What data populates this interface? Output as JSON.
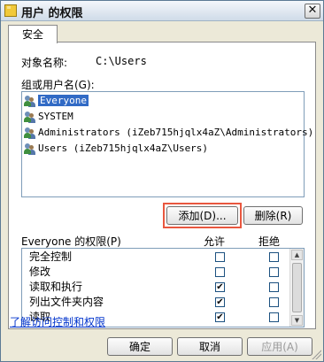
{
  "window": {
    "title": "用户 的权限",
    "close_label": "✕"
  },
  "tabs": [
    {
      "label": "安全"
    }
  ],
  "object": {
    "label": "对象名称:",
    "value": "C:\\Users"
  },
  "group_list": {
    "label": "组或用户名(G):",
    "items": [
      {
        "name": "Everyone",
        "selected": true
      },
      {
        "name": "SYSTEM",
        "selected": false
      },
      {
        "name": "Administrators (iZeb715hjqlx4aZ\\Administrators)",
        "selected": false
      },
      {
        "name": "Users (iZeb715hjqlx4aZ\\Users)",
        "selected": false
      }
    ]
  },
  "buttons": {
    "add": "添加(D)...",
    "remove": "删除(R)",
    "ok": "确定",
    "cancel": "取消",
    "apply": "应用(A)"
  },
  "permissions": {
    "title": "Everyone 的权限(P)",
    "allow_header": "允许",
    "deny_header": "拒绝",
    "rows": [
      {
        "name": "完全控制",
        "allow": false,
        "deny": false
      },
      {
        "name": "修改",
        "allow": false,
        "deny": false
      },
      {
        "name": "读取和执行",
        "allow": true,
        "deny": false
      },
      {
        "name": "列出文件夹内容",
        "allow": true,
        "deny": false
      },
      {
        "name": "读取",
        "allow": true,
        "deny": false
      }
    ]
  },
  "help_link": "了解访问控制和权限",
  "colors": {
    "highlight_border": "#e9573f",
    "selection": "#316ac5",
    "link": "#0033cc"
  }
}
